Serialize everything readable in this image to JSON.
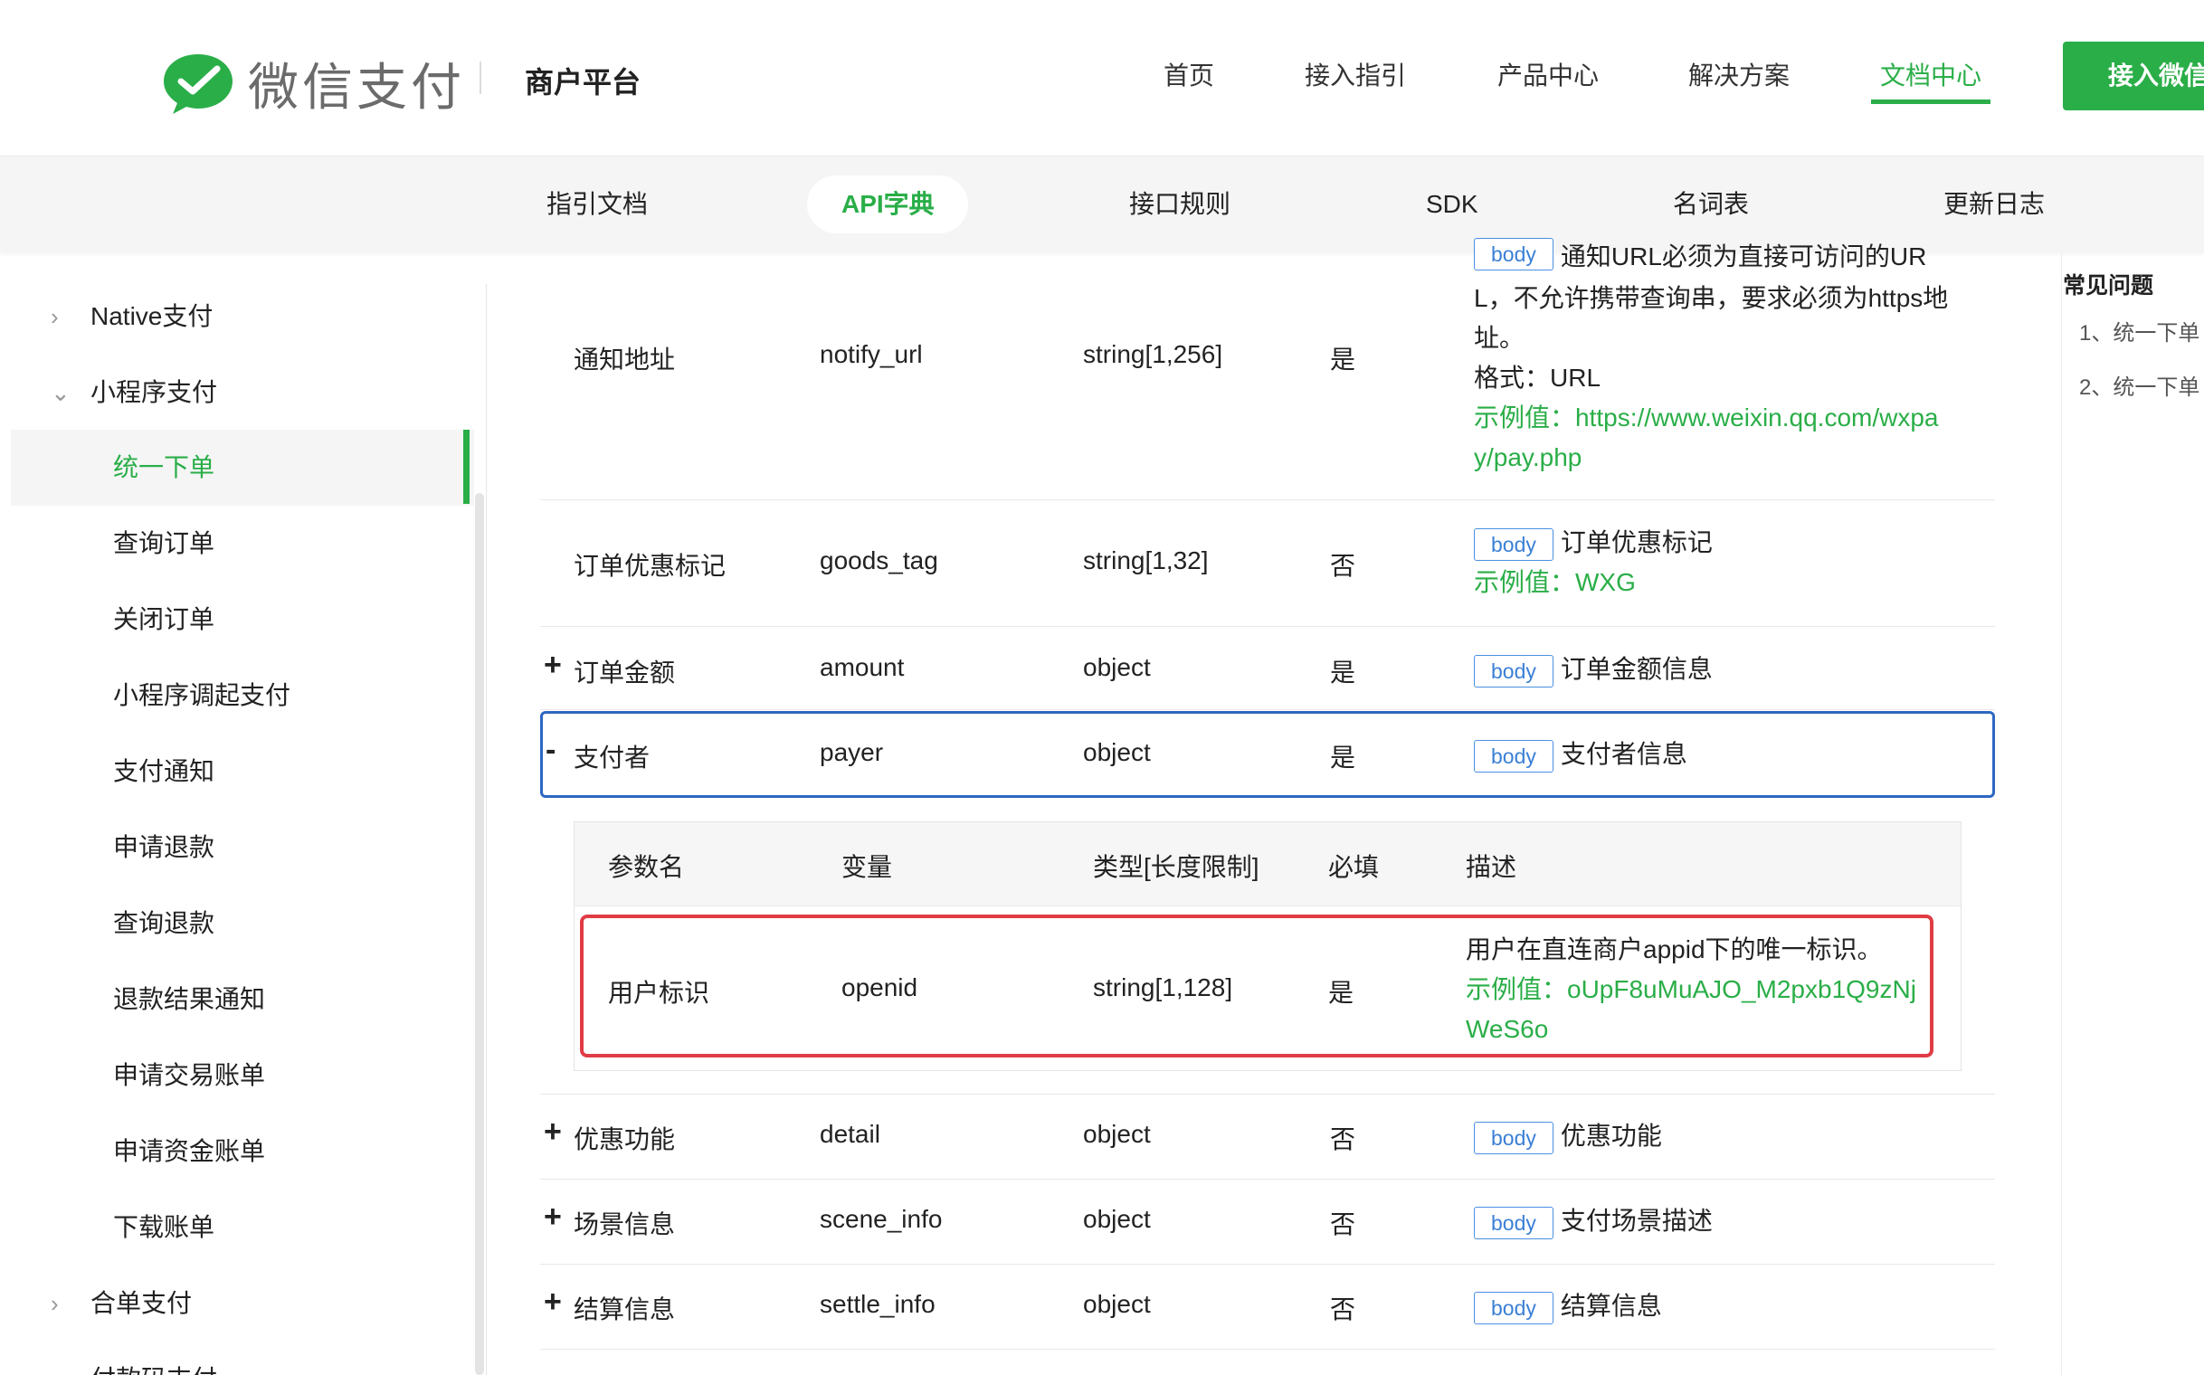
{
  "header": {
    "brand": "微信支付",
    "platform": "商户平台",
    "nav": [
      "首页",
      "接入指引",
      "产品中心",
      "解决方案",
      "文档中心"
    ],
    "active_nav": "文档中心",
    "cta": "接入微信"
  },
  "subnav": {
    "items": [
      "指引文档",
      "API字典",
      "接口规则",
      "SDK",
      "名词表",
      "更新日志"
    ],
    "active": "API字典"
  },
  "sidebar": {
    "items": [
      {
        "label": "Native支付",
        "arrow": "›"
      },
      {
        "label": "小程序支付",
        "arrow": "⌄"
      },
      {
        "label": "统一下单"
      },
      {
        "label": "查询订单"
      },
      {
        "label": "关闭订单"
      },
      {
        "label": "小程序调起支付"
      },
      {
        "label": "支付通知"
      },
      {
        "label": "申请退款"
      },
      {
        "label": "查询退款"
      },
      {
        "label": "退款结果通知"
      },
      {
        "label": "申请交易账单"
      },
      {
        "label": "申请资金账单"
      },
      {
        "label": "下载账单"
      },
      {
        "label": "合单支付",
        "arrow": "›"
      },
      {
        "label": "付款码支付"
      }
    ]
  },
  "table": {
    "rows": [
      {
        "name": "通知地址",
        "var": "notify_url",
        "type": "string[1,256]",
        "required": "是",
        "tag": "body",
        "desc_top": "通知URL必须为直接可访问的UR",
        "desc_lines": [
          "L，不允许携带查询串，要求必须为https地",
          "址。",
          "格式：URL"
        ],
        "example_lines": [
          "示例值：https://www.weixin.qq.com/wxpa",
          "y/pay.php"
        ]
      },
      {
        "name": "订单优惠标记",
        "var": "goods_tag",
        "type": "string[1,32]",
        "required": "否",
        "tag": "body",
        "desc": "订单优惠标记",
        "example": "示例值：WXG"
      },
      {
        "expander": "+",
        "name": "订单金额",
        "var": "amount",
        "type": "object",
        "required": "是",
        "tag": "body",
        "desc": "订单金额信息"
      },
      {
        "expander": "-",
        "name": "支付者",
        "var": "payer",
        "type": "object",
        "required": "是",
        "tag": "body",
        "desc": "支付者信息"
      },
      {
        "expander": "+",
        "name": "优惠功能",
        "var": "detail",
        "type": "object",
        "required": "否",
        "tag": "body",
        "desc": "优惠功能"
      },
      {
        "expander": "+",
        "name": "场景信息",
        "var": "scene_info",
        "type": "object",
        "required": "否",
        "tag": "body",
        "desc": "支付场景描述"
      },
      {
        "expander": "+",
        "name": "结算信息",
        "var": "settle_info",
        "type": "object",
        "required": "否",
        "tag": "body",
        "desc": "结算信息"
      }
    ],
    "subtable": {
      "headers": [
        "参数名",
        "变量",
        "类型[长度限制]",
        "必填",
        "描述"
      ],
      "row": {
        "name": "用户标识",
        "var": "openid",
        "type": "string[1,128]",
        "required": "是",
        "desc": "用户在直连商户appid下的唯一标识。",
        "example_lines": [
          "示例值：oUpF8uMuAJO_M2pxb1Q9zNj",
          "WeS6o"
        ]
      }
    }
  },
  "aside": {
    "title": "常见问题",
    "items": [
      "1、统一下单",
      "2、统一下单"
    ]
  },
  "colors": {
    "brand_green": "#2aae48",
    "highlight_blue": "#2e67c2",
    "highlight_red": "#e03c45",
    "tag_blue": "#4a90e2"
  }
}
